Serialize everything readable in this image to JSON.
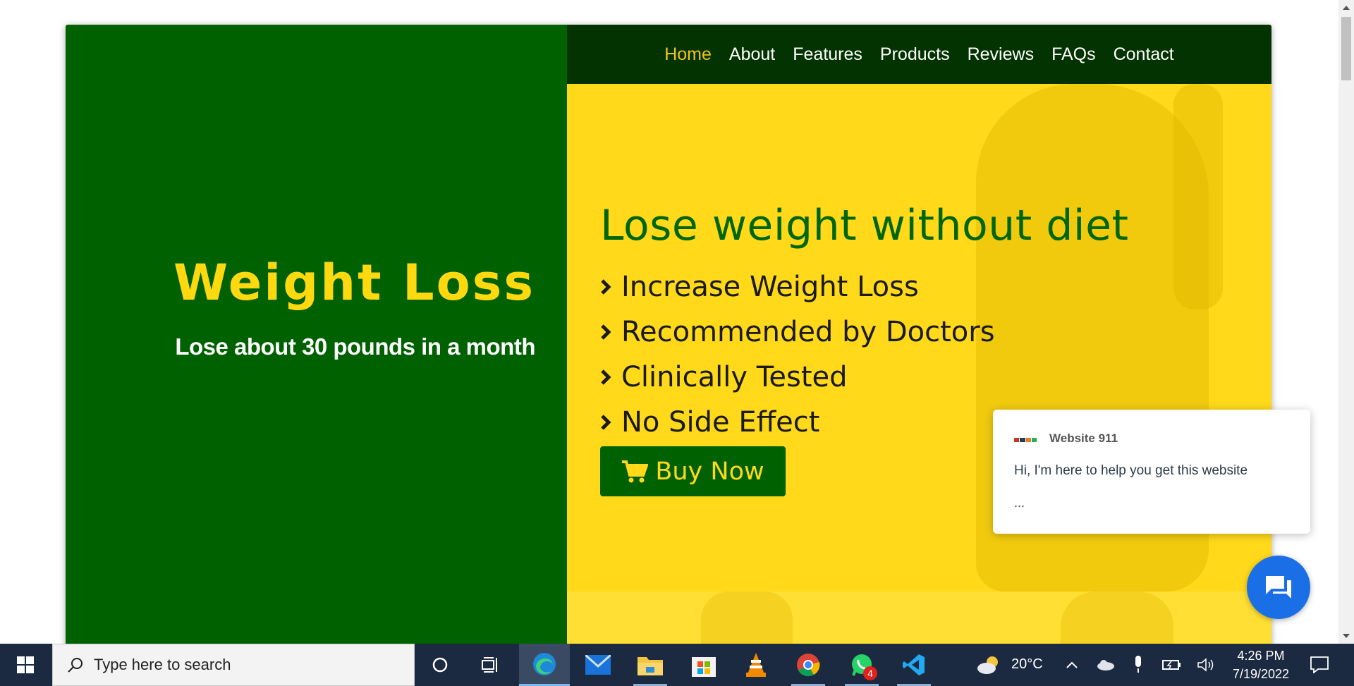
{
  "nav": {
    "items": [
      {
        "label": "Home",
        "active": true
      },
      {
        "label": "About",
        "active": false
      },
      {
        "label": "Features",
        "active": false
      },
      {
        "label": "Products",
        "active": false
      },
      {
        "label": "Reviews",
        "active": false
      },
      {
        "label": "FAQs",
        "active": false
      },
      {
        "label": "Contact",
        "active": false
      }
    ]
  },
  "brand": {
    "title": "Weight Loss",
    "subtitle": "Lose about 30 pounds in a month"
  },
  "hero": {
    "heading": "Lose weight without diet",
    "features": [
      "Increase Weight Loss",
      "Recommended by Doctors",
      "Clinically Tested",
      "No Side Effect"
    ],
    "buy_label": "Buy Now"
  },
  "chat": {
    "name": "Website 911",
    "message": "Hi, I'm here to help you get this website",
    "dots": "..."
  },
  "taskbar": {
    "search_placeholder": "Type here to search",
    "temperature": "20°C",
    "time": "4:26 PM",
    "date": "7/19/2022",
    "whatsapp_badge": "4"
  },
  "colors": {
    "brand_green": "#006100",
    "nav_dark_green": "#033300",
    "accent_yellow": "#ffd91a",
    "chat_blue": "#1b6fe6"
  }
}
